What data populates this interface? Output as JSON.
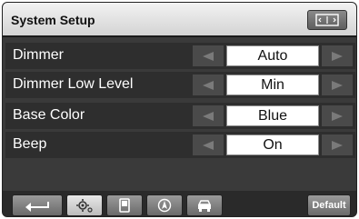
{
  "header": {
    "title": "System Setup",
    "screen_button_icon": "screen-adjust-icon"
  },
  "settings": [
    {
      "label": "Dimmer",
      "value": "Auto"
    },
    {
      "label": "Dimmer Low Level",
      "value": "Min"
    },
    {
      "label": "Base Color",
      "value": "Blue"
    },
    {
      "label": "Beep",
      "value": "On"
    }
  ],
  "arrows": {
    "left_icon": "arrow-left-icon",
    "right_icon": "arrow-right-icon"
  },
  "footer": {
    "tabs": [
      {
        "icon": "back-icon"
      },
      {
        "icon": "settings-gear-icon"
      },
      {
        "icon": "phone-icon"
      },
      {
        "icon": "navigation-icon"
      },
      {
        "icon": "car-icon"
      }
    ],
    "default_label": "Default"
  },
  "colors": {
    "background": "#3a3a3a",
    "title_bar": "#e0e0e0",
    "value_box": "#ffffff",
    "text_light": "#ffffff"
  }
}
